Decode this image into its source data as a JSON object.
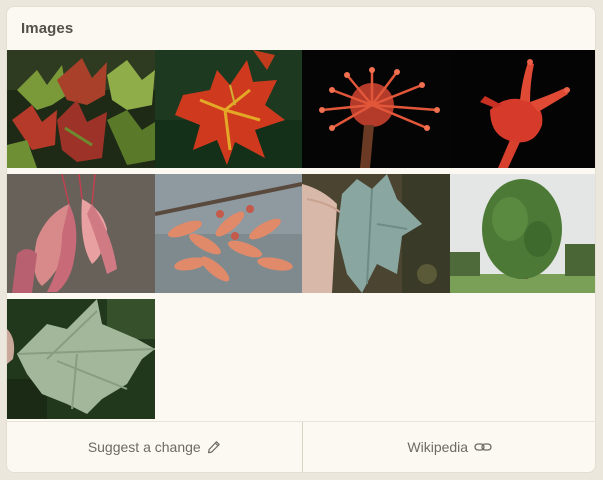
{
  "panel": {
    "title": "Images"
  },
  "images": [
    {
      "name": "image-leaves-red-green",
      "alt": "",
      "theme": "leaves-red-green"
    },
    {
      "name": "image-red-leaf",
      "alt": "",
      "theme": "red-leaf"
    },
    {
      "name": "image-red-flowers",
      "alt": "",
      "theme": "red-flowers"
    },
    {
      "name": "image-red-flower-closeup",
      "alt": "",
      "theme": "red-flower-closeup"
    },
    {
      "name": "image-samaras-pink",
      "alt": "",
      "theme": "samaras-pink"
    },
    {
      "name": "image-samaras-branch",
      "alt": "",
      "theme": "samaras-branch"
    },
    {
      "name": "image-leaf-in-hand",
      "alt": "",
      "theme": "leaf-in-hand"
    },
    {
      "name": "image-tree",
      "alt": "",
      "theme": "tree"
    },
    {
      "name": "image-leaf-underside",
      "alt": "",
      "theme": "leaf-underside"
    }
  ],
  "footer": {
    "suggest_label": "Suggest a change",
    "suggest_icon": "pencil-icon",
    "wikipedia_label": "Wikipedia",
    "wikipedia_icon": "link-icon"
  },
  "colors": {
    "background": "#ece7dc",
    "card": "#fbf9f2",
    "title": "#55504a",
    "footer_text": "#6f6a62"
  }
}
